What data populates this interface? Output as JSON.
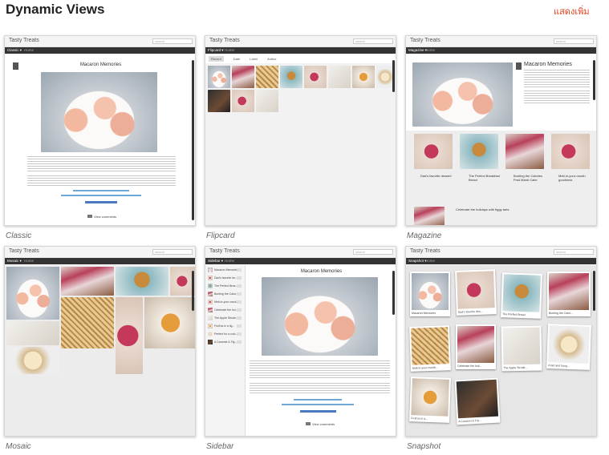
{
  "header": {
    "title": "Dynamic Views",
    "more_link": "แสดงเพิ่ม"
  },
  "preview": {
    "blog_title": "Tasty Treats",
    "search_placeholder": "search",
    "home": "Home"
  },
  "views": [
    {
      "label": "Classic",
      "nav_selected": "Classic ▾"
    },
    {
      "label": "Flipcard",
      "nav_selected": "Flipcard ▾"
    },
    {
      "label": "Magazine",
      "nav_selected": "Magazine ▾"
    },
    {
      "label": "Mosaic",
      "nav_selected": "Mosaic ▾"
    },
    {
      "label": "Sidebar",
      "nav_selected": "Sidebar ▾"
    },
    {
      "label": "Snapshot",
      "nav_selected": "Snapshot ▾"
    }
  ],
  "post": {
    "title": "Macaron Memories",
    "view_comments": "View comments"
  },
  "flipcard_tabs": [
    "Recent",
    "Date",
    "Label",
    "Author"
  ],
  "magazine_items": [
    "Dad's favorite dessert",
    "The Perfect Breakfast Bread",
    "Bunting the Calories Post Mardi Cake",
    "Melt-in-your-mouth goodness",
    "Celebrate the holidays with figgy tarts"
  ],
  "sidebar_items": [
    "Macaron Memories",
    "Dad's favorite de...",
    "The Perfect Brea...",
    "Bunting the Calor...",
    "Melt-in-your-mout...",
    "Celebrate the hol...",
    "The Apple Strude...",
    "Fruit'za in a lig...",
    "Perfect for a colo...",
    "A Caramel & Fig..."
  ],
  "snapshot_items": [
    "Macaron Memories",
    "Dad's favorite des...",
    "The Perfect Bread",
    "Bunting the Calor...",
    "Melt-in-your-mouth...",
    "Celebrate the holi...",
    "The Apple Strude...",
    "A tart and hung...",
    "Fruit'za in a...",
    "A Caramel & Fig..."
  ]
}
